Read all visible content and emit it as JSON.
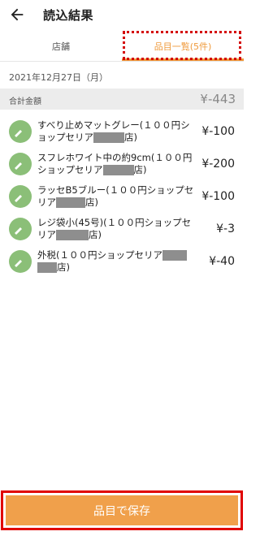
{
  "appbar": {
    "title": "読込結果",
    "back_icon": "arrow-left-icon"
  },
  "tabs": [
    {
      "label": "店舗",
      "active": false
    },
    {
      "label": "品目一覧(5件)",
      "active": true
    }
  ],
  "receipt": {
    "date": "2021年12月27日（月）",
    "total_label": "合計金額",
    "total_value": "¥-443"
  },
  "items": [
    {
      "icon": "broom-icon",
      "name_before": "すべり止めマットグレー(１００円ショップセリア",
      "name_after": "店)",
      "price": "¥-100"
    },
    {
      "icon": "broom-icon",
      "name_before": "スフレホワイト中の約9cm(１００円ショップセリア",
      "name_after": "店)",
      "price": "¥-200"
    },
    {
      "icon": "broom-icon",
      "name_before": "ラッセB5ブルー(１００円ショップセリア",
      "name_after": "店)",
      "price": "¥-100"
    },
    {
      "icon": "broom-icon",
      "name_before": "レジ袋小(45号)(１００円ショップセリア",
      "name_after": "店)",
      "price": "¥-3"
    },
    {
      "icon": "broom-icon",
      "name_before": "外税(１００円ショップセリア",
      "name_after": "店)",
      "price": "¥-40"
    }
  ],
  "footer": {
    "save_label": "品目で保存"
  },
  "colors": {
    "accent": "#ef9a3c",
    "button": "#f0a04b",
    "icon_bg": "#8bbf78",
    "highlight": "#e00000"
  }
}
